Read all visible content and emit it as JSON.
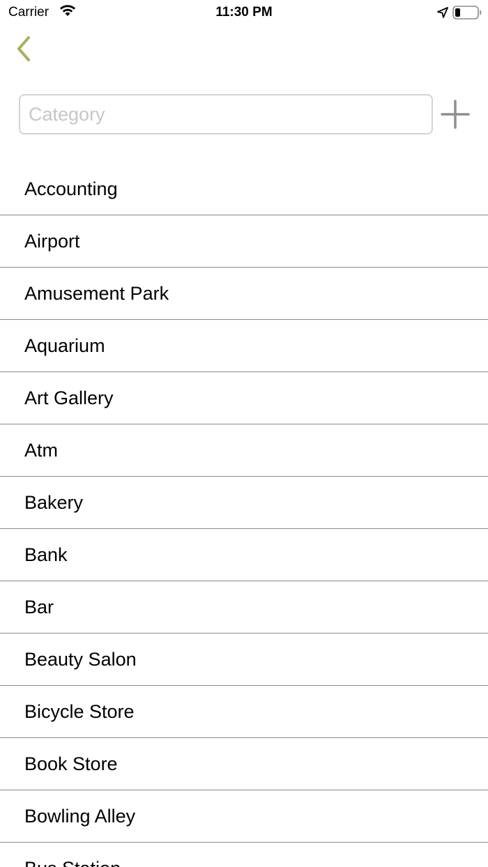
{
  "status_bar": {
    "carrier": "Carrier",
    "time": "11:30 PM",
    "icons": [
      "wifi-icon",
      "location-arrow-icon",
      "battery-icon"
    ]
  },
  "nav": {
    "back_icon": "chevron-left-icon",
    "accent_color": "#a6b25e"
  },
  "category_field": {
    "value": "",
    "placeholder": "Category"
  },
  "add_button": {
    "icon": "plus-icon",
    "color": "#8e8e8e"
  },
  "categories": [
    "Accounting",
    "Airport",
    "Amusement Park",
    "Aquarium",
    "Art Gallery",
    "Atm",
    "Bakery",
    "Bank",
    "Bar",
    "Beauty Salon",
    "Bicycle Store",
    "Book Store",
    "Bowling Alley",
    "Bus Station"
  ]
}
